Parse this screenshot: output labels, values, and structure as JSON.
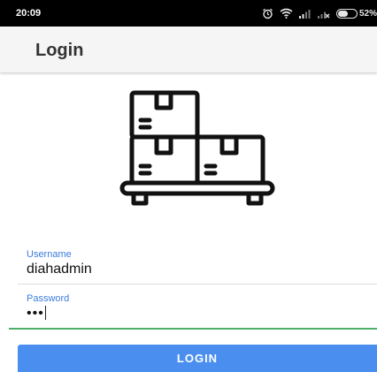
{
  "status_bar": {
    "time": "20:09",
    "battery_percent": "52%",
    "icons": [
      "alarm-icon",
      "wifi-icon",
      "signal-icon",
      "signal-no-sim-icon",
      "battery-icon"
    ]
  },
  "app_bar": {
    "title": "Login"
  },
  "logo": {
    "icon": "boxes-on-pallet-icon"
  },
  "form": {
    "username": {
      "label": "Username",
      "value": "diahadmin"
    },
    "password": {
      "label": "Password",
      "value": "•••"
    },
    "login_label": "LOGIN"
  },
  "colors": {
    "accent": "#4a8ff0",
    "label_blue": "#3b7ddd",
    "focus_green": "#4caf6a",
    "status_bar": "#000000"
  }
}
